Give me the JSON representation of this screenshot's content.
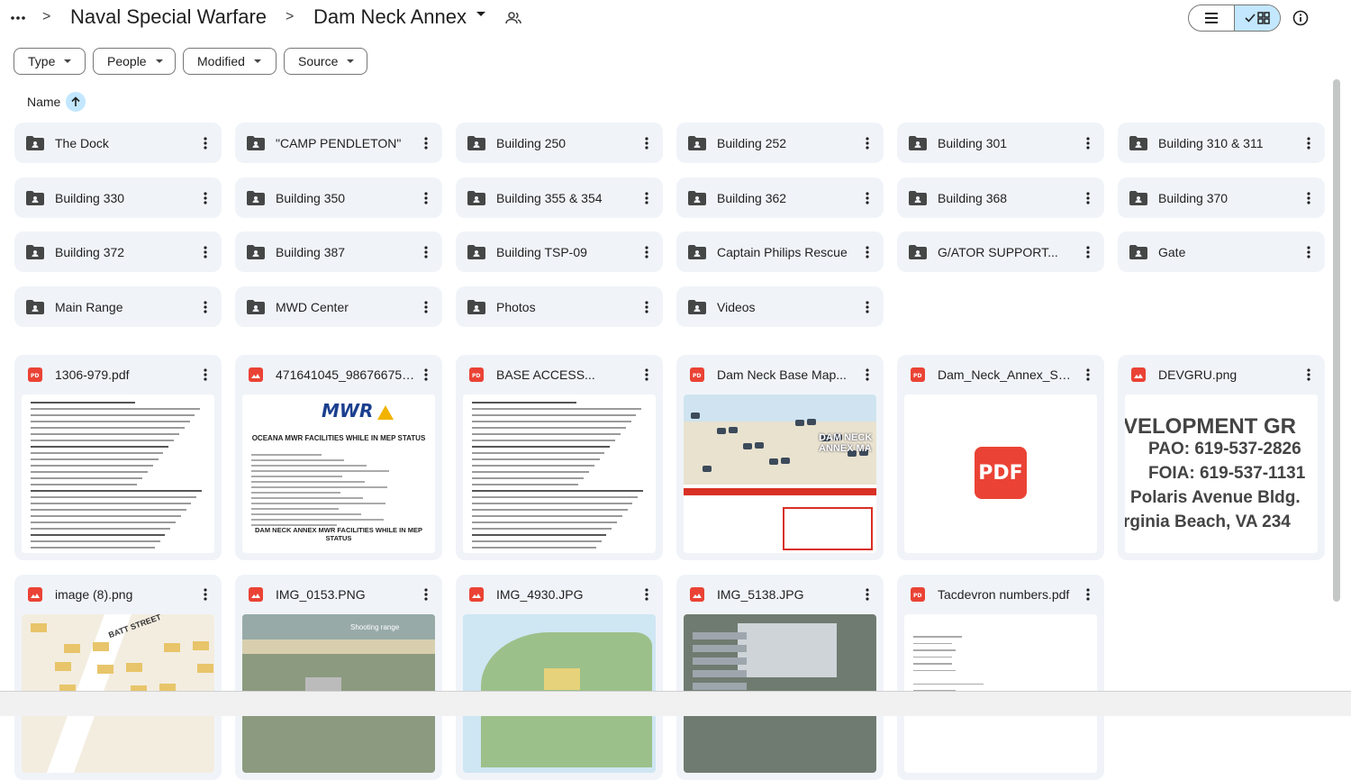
{
  "breadcrumb": {
    "parent": "Naval Special Warfare",
    "current": "Dam Neck Annex",
    "separator": ">"
  },
  "filters": [
    {
      "label": "Type"
    },
    {
      "label": "People"
    },
    {
      "label": "Modified"
    },
    {
      "label": "Source"
    }
  ],
  "sort": {
    "label": "Name",
    "direction": "ascending"
  },
  "folders": [
    {
      "name": "The Dock"
    },
    {
      "name": "\"CAMP PENDLETON\""
    },
    {
      "name": "Building 250"
    },
    {
      "name": "Building 252"
    },
    {
      "name": "Building 301"
    },
    {
      "name": "Building 310 & 311"
    },
    {
      "name": "Building 330"
    },
    {
      "name": "Building 350"
    },
    {
      "name": "Building 355 & 354"
    },
    {
      "name": "Building 362"
    },
    {
      "name": "Building 368"
    },
    {
      "name": "Building 370"
    },
    {
      "name": "Building 372"
    },
    {
      "name": "Building 387"
    },
    {
      "name": "Building TSP-09"
    },
    {
      "name": "Captain Philips Rescue"
    },
    {
      "name": "G/ATOR SUPPORT..."
    },
    {
      "name": "Gate"
    },
    {
      "name": "Main Range"
    },
    {
      "name": "MWD Center"
    },
    {
      "name": "Photos"
    },
    {
      "name": "Videos"
    }
  ],
  "files": [
    {
      "name": "1306-979.pdf",
      "type": "pdf",
      "thumb": "doc"
    },
    {
      "name": "471641045_986766750...",
      "type": "image",
      "thumb": "mwr",
      "thumb_title": "OCEANA MWR FACILITIES WHILE IN MEP STATUS",
      "thumb_footer": "DAM NECK ANNEX MWR FACILITIES WHILE IN MEP STATUS",
      "thumb_logo": "MWR"
    },
    {
      "name": "BASE ACCESS...",
      "type": "pdf",
      "thumb": "doc"
    },
    {
      "name": "Dam Neck Base Map...",
      "type": "pdf",
      "thumb": "map",
      "thumb_title": "DAM NECK ANNEX MA"
    },
    {
      "name": "Dam_Neck_Annex_SM...",
      "type": "pdf",
      "thumb": "pdf-icon",
      "badge": "PDF"
    },
    {
      "name": "DEVGRU.png",
      "type": "image",
      "thumb": "devgru",
      "thumb_lines": [
        "VELOPMENT GR",
        "PAO: 619-537-2826",
        "FOIA: 619-537-1131",
        "Polaris Avenue  Bldg.",
        "rginia Beach, VA  234"
      ]
    },
    {
      "name": "image (8).png",
      "type": "image",
      "thumb": "street-map",
      "thumb_label": "BATT STREET"
    },
    {
      "name": "IMG_0153.PNG",
      "type": "image",
      "thumb": "aerial-beach",
      "thumb_label": "Shooting range"
    },
    {
      "name": "IMG_4930.JPG",
      "type": "image",
      "thumb": "aerial-green"
    },
    {
      "name": "IMG_5138.JPG",
      "type": "image",
      "thumb": "aerial-parking"
    },
    {
      "name": "Tacdevron numbers.pdf",
      "type": "pdf",
      "thumb": "doc-sparse"
    }
  ],
  "colors": {
    "card_bg": "#f0f4f9",
    "pdf_red": "#ea4335",
    "image_red": "#ea4335",
    "toggle_active": "#c2e7ff"
  }
}
